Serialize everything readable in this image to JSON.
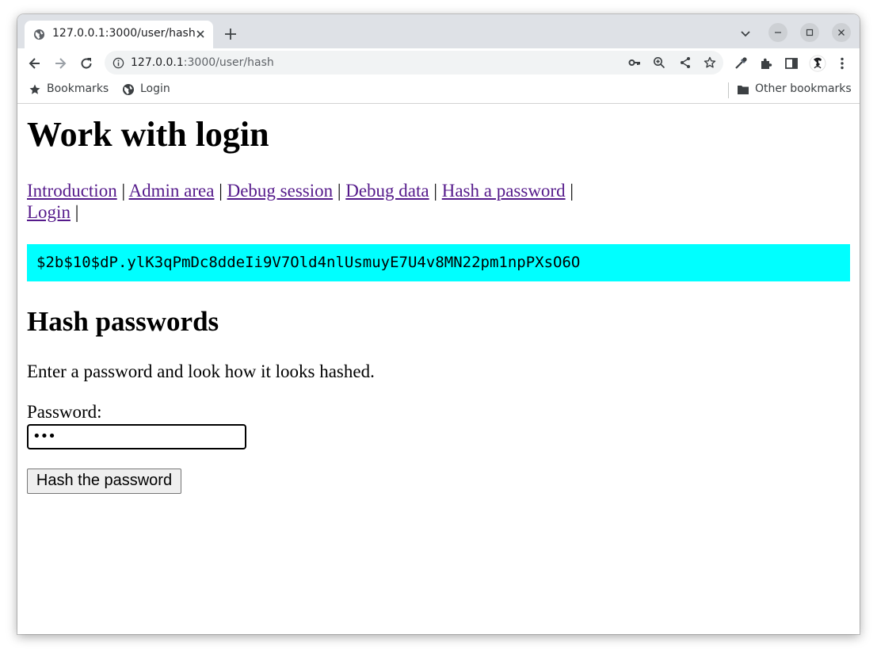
{
  "browser": {
    "tab_title": "127.0.0.1:3000/user/hash",
    "url_host": "127.0.0.1",
    "url_path": ":3000/user/hash",
    "bookmarks": [
      {
        "label": "Bookmarks",
        "icon": "star-icon"
      },
      {
        "label": "Login",
        "icon": "globe-icon"
      }
    ],
    "other_bookmarks": "Other bookmarks"
  },
  "page": {
    "title": "Work with login",
    "nav": [
      {
        "label": "Introduction"
      },
      {
        "label": "Admin area"
      },
      {
        "label": "Debug session"
      },
      {
        "label": "Debug data"
      },
      {
        "label": "Hash a password"
      },
      {
        "label": "Login"
      }
    ],
    "separator": "|",
    "hash_result": "$2b$10$dP.ylK3qPmDc8ddeIi9V7Old4nlUsmuyE7U4v8MN22pm1npPXsO6O",
    "section_title": "Hash passwords",
    "description": "Enter a password and look how it looks hashed.",
    "password_label": "Password:",
    "password_value": "•••",
    "submit_label": "Hash the password"
  },
  "colors": {
    "hash_background": "#00ffff",
    "link": "#551a8b",
    "tabstrip": "#dee1e6"
  }
}
